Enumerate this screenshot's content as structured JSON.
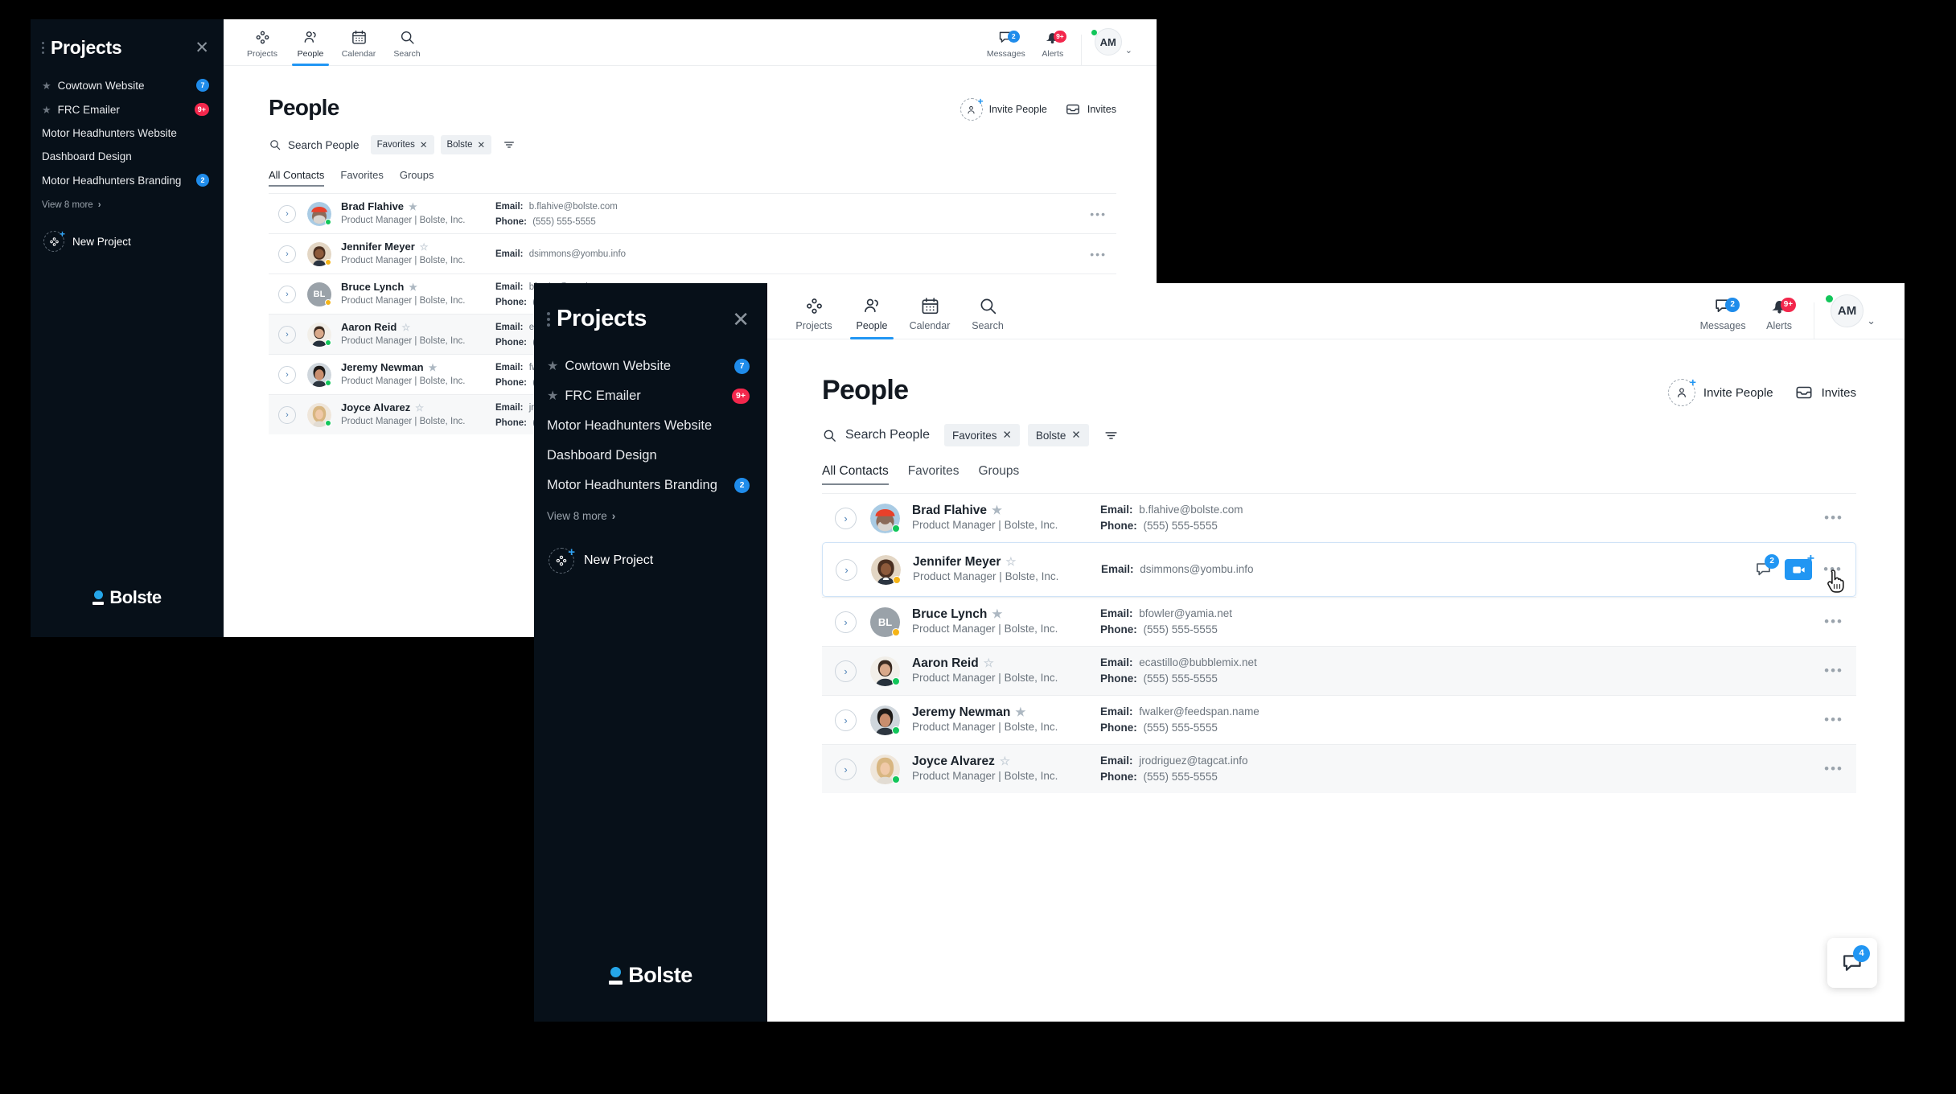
{
  "sidebar": {
    "title": "Projects",
    "close_icon": "close-icon",
    "items": [
      {
        "label": "Cowtown Website",
        "badge": "7",
        "badge_color": "#1f8ceb",
        "favorite": true
      },
      {
        "label": "FRC Emailer",
        "badge": "9+",
        "badge_color": "#f3274c",
        "favorite": true
      },
      {
        "label": "Motor Headhunters Website",
        "badge": "",
        "favorite": false
      },
      {
        "label": "Dashboard Design",
        "badge": "",
        "favorite": false
      },
      {
        "label": "Motor Headhunters Branding",
        "badge": "2",
        "badge_color": "#1f8ceb",
        "favorite": false
      }
    ],
    "view_more": "View 8 more",
    "new_project": "New Project",
    "brand": "Bolste"
  },
  "topnav": {
    "items": [
      {
        "label": "Projects",
        "icon": "projects-icon",
        "active": false
      },
      {
        "label": "People",
        "icon": "people-icon",
        "active": true
      },
      {
        "label": "Calendar",
        "icon": "calendar-icon",
        "active": false
      },
      {
        "label": "Search",
        "icon": "search-icon",
        "active": false
      }
    ],
    "messages": {
      "label": "Messages",
      "badge": "2",
      "badge_color": "#2196f3",
      "icon": "message-icon"
    },
    "alerts": {
      "label": "Alerts",
      "badge": "9+",
      "badge_color": "#f3274c",
      "icon": "bell-icon"
    },
    "avatar": {
      "initials": "AM",
      "status_color": "#12c65a",
      "chevron": "chevron-down-icon"
    }
  },
  "page": {
    "title": "People",
    "invite_people": "Invite People",
    "invites": "Invites",
    "search_placeholder": "Search People",
    "chips": [
      {
        "label": "Favorites",
        "remove": "✕"
      },
      {
        "label": "Bolste",
        "remove": "✕"
      }
    ],
    "tabs": [
      {
        "label": "All Contacts",
        "active": true
      },
      {
        "label": "Favorites",
        "active": false
      },
      {
        "label": "Groups",
        "active": false
      }
    ]
  },
  "contacts": [
    {
      "name": "Brad Flahive",
      "favorite": true,
      "role": "Product Manager | Bolste, Inc.",
      "email_label": "Email:",
      "email": "b.flahive@bolste.com",
      "phone_label": "Phone:",
      "phone": "(555) 555-5555",
      "presence": "online",
      "avatar_type": "photo",
      "avatar_initials": "",
      "selected": false,
      "shaded": false
    },
    {
      "name": "Jennifer Meyer",
      "favorite": false,
      "role": "Product Manager | Bolste, Inc.",
      "email_label": "Email:",
      "email": "dsimmons@yombu.info",
      "phone_label": "",
      "phone": "",
      "presence": "away",
      "avatar_type": "photo",
      "avatar_initials": "",
      "selected": true,
      "shaded": false,
      "message_badge": "2"
    },
    {
      "name": "Bruce Lynch",
      "favorite": true,
      "role": "Product Manager | Bolste, Inc.",
      "email_label": "Email:",
      "email": "bfowler@yamia.net",
      "phone_label": "Phone:",
      "phone": "(555) 555-5555",
      "presence": "away",
      "avatar_type": "initials",
      "avatar_initials": "BL",
      "selected": false,
      "shaded": false
    },
    {
      "name": "Aaron Reid",
      "favorite": false,
      "role": "Product Manager | Bolste, Inc.",
      "email_label": "Email:",
      "email": "ecastillo@bubblemix.net",
      "phone_label": "Phone:",
      "phone": "(555) 555-5555",
      "presence": "online",
      "avatar_type": "photo",
      "avatar_initials": "",
      "selected": false,
      "shaded": true
    },
    {
      "name": "Jeremy Newman",
      "favorite": true,
      "role": "Product Manager | Bolste, Inc.",
      "email_label": "Email:",
      "email": "fwalker@feedspan.name",
      "phone_label": "Phone:",
      "phone": "(555) 555-5555",
      "presence": "online",
      "avatar_type": "photo",
      "avatar_initials": "",
      "selected": false,
      "shaded": false
    },
    {
      "name": "Joyce Alvarez",
      "favorite": false,
      "role": "Product Manager | Bolste, Inc.",
      "email_label": "Email:",
      "email": "jrodriguez@tagcat.info",
      "phone_label": "Phone:",
      "phone": "(555) 555-5555",
      "presence": "online",
      "avatar_type": "photo",
      "avatar_initials": "",
      "selected": false,
      "shaded": true
    }
  ],
  "chat_fab": {
    "badge": "4",
    "icon": "chat-icon"
  },
  "row_menu_icon": "more-options-icon",
  "expander_icon": "chevron-right-icon"
}
